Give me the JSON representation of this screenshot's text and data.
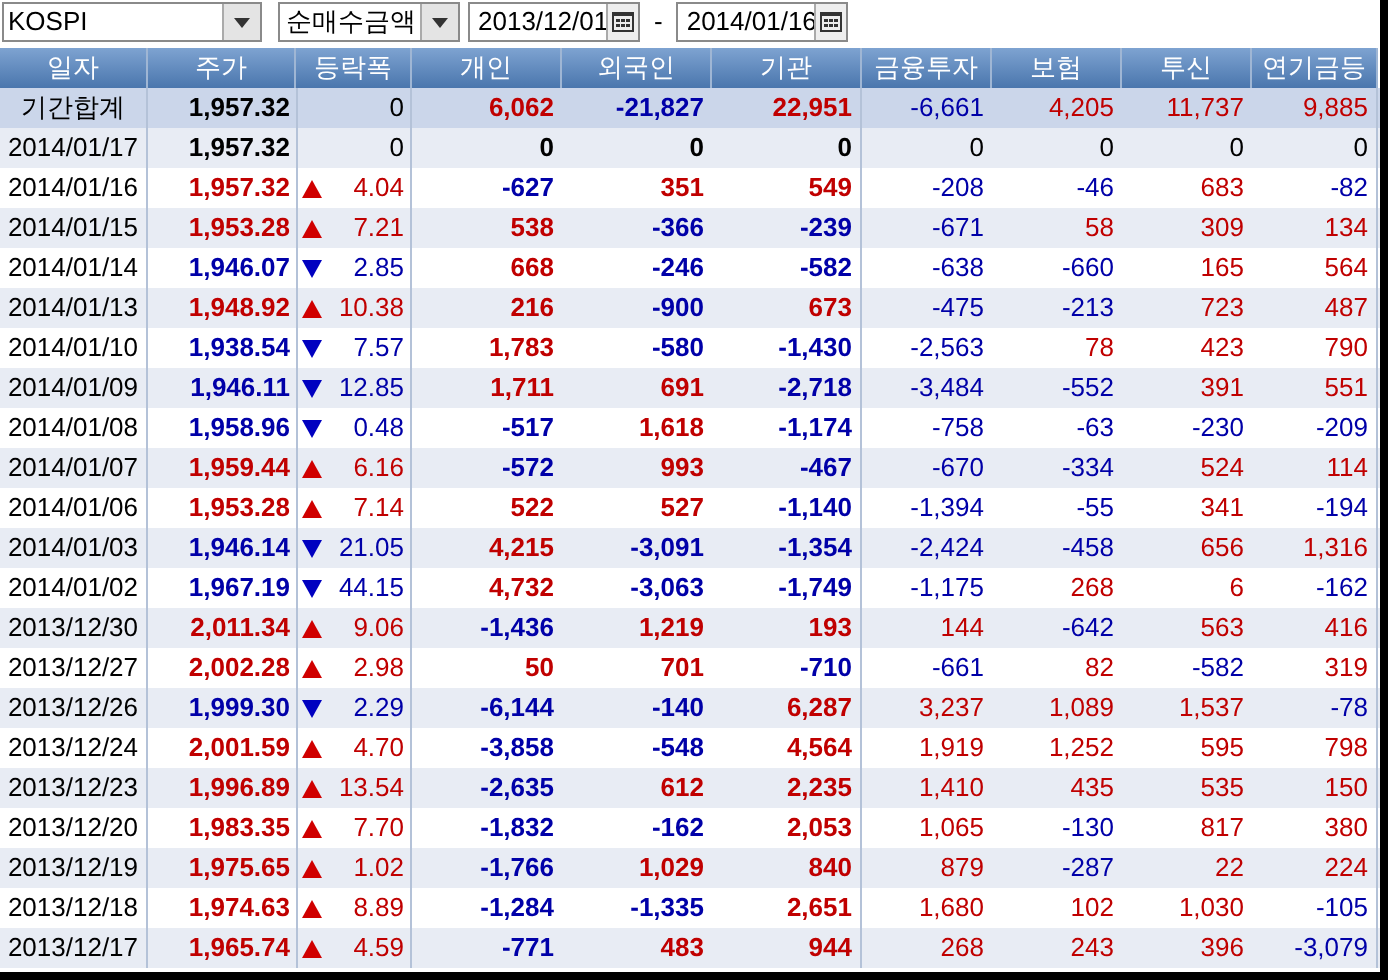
{
  "toolbar": {
    "market": "KOSPI",
    "measure": "순매수금액",
    "start_date": "2013/12/01",
    "separator": "-",
    "end_date": "2014/01/16"
  },
  "table": {
    "columns": [
      "일자",
      "주가",
      "등락폭",
      "개인",
      "외국인",
      "기관",
      "금융투자",
      "보험",
      "투신",
      "연기금등"
    ],
    "rows": [
      {
        "kind": "total",
        "rising": false,
        "falling": false,
        "cells": [
          "기간합계",
          "1,957.32",
          "0",
          "6,062",
          "-21,827",
          "22,951",
          "-6,661",
          "4,205",
          "11,737",
          "9,885"
        ]
      },
      {
        "kind": "day",
        "rising": false,
        "falling": false,
        "cells": [
          "2014/01/17",
          "1,957.32",
          "0",
          "0",
          "0",
          "0",
          "0",
          "0",
          "0",
          "0"
        ]
      },
      {
        "kind": "day",
        "rising": true,
        "falling": false,
        "cells": [
          "2014/01/16",
          "1,957.32",
          "4.04",
          "-627",
          "351",
          "549",
          "-208",
          "-46",
          "683",
          "-82"
        ]
      },
      {
        "kind": "day",
        "rising": true,
        "falling": false,
        "cells": [
          "2014/01/15",
          "1,953.28",
          "7.21",
          "538",
          "-366",
          "-239",
          "-671",
          "58",
          "309",
          "134"
        ]
      },
      {
        "kind": "day",
        "rising": false,
        "falling": true,
        "cells": [
          "2014/01/14",
          "1,946.07",
          "2.85",
          "668",
          "-246",
          "-582",
          "-638",
          "-660",
          "165",
          "564"
        ]
      },
      {
        "kind": "day",
        "rising": true,
        "falling": false,
        "cells": [
          "2014/01/13",
          "1,948.92",
          "10.38",
          "216",
          "-900",
          "673",
          "-475",
          "-213",
          "723",
          "487"
        ]
      },
      {
        "kind": "day",
        "rising": false,
        "falling": true,
        "cells": [
          "2014/01/10",
          "1,938.54",
          "7.57",
          "1,783",
          "-580",
          "-1,430",
          "-2,563",
          "78",
          "423",
          "790"
        ]
      },
      {
        "kind": "day",
        "rising": false,
        "falling": true,
        "cells": [
          "2014/01/09",
          "1,946.11",
          "12.85",
          "1,711",
          "691",
          "-2,718",
          "-3,484",
          "-552",
          "391",
          "551"
        ]
      },
      {
        "kind": "day",
        "rising": false,
        "falling": true,
        "cells": [
          "2014/01/08",
          "1,958.96",
          "0.48",
          "-517",
          "1,618",
          "-1,174",
          "-758",
          "-63",
          "-230",
          "-209"
        ]
      },
      {
        "kind": "day",
        "rising": true,
        "falling": false,
        "cells": [
          "2014/01/07",
          "1,959.44",
          "6.16",
          "-572",
          "993",
          "-467",
          "-670",
          "-334",
          "524",
          "114"
        ]
      },
      {
        "kind": "day",
        "rising": true,
        "falling": false,
        "cells": [
          "2014/01/06",
          "1,953.28",
          "7.14",
          "522",
          "527",
          "-1,140",
          "-1,394",
          "-55",
          "341",
          "-194"
        ]
      },
      {
        "kind": "day",
        "rising": false,
        "falling": true,
        "cells": [
          "2014/01/03",
          "1,946.14",
          "21.05",
          "4,215",
          "-3,091",
          "-1,354",
          "-2,424",
          "-458",
          "656",
          "1,316"
        ]
      },
      {
        "kind": "day",
        "rising": false,
        "falling": true,
        "cells": [
          "2014/01/02",
          "1,967.19",
          "44.15",
          "4,732",
          "-3,063",
          "-1,749",
          "-1,175",
          "268",
          "6",
          "-162"
        ]
      },
      {
        "kind": "day",
        "rising": true,
        "falling": false,
        "cells": [
          "2013/12/30",
          "2,011.34",
          "9.06",
          "-1,436",
          "1,219",
          "193",
          "144",
          "-642",
          "563",
          "416"
        ]
      },
      {
        "kind": "day",
        "rising": true,
        "falling": false,
        "cells": [
          "2013/12/27",
          "2,002.28",
          "2.98",
          "50",
          "701",
          "-710",
          "-661",
          "82",
          "-582",
          "319"
        ]
      },
      {
        "kind": "day",
        "rising": false,
        "falling": true,
        "cells": [
          "2013/12/26",
          "1,999.30",
          "2.29",
          "-6,144",
          "-140",
          "6,287",
          "3,237",
          "1,089",
          "1,537",
          "-78"
        ]
      },
      {
        "kind": "day",
        "rising": true,
        "falling": false,
        "cells": [
          "2013/12/24",
          "2,001.59",
          "4.70",
          "-3,858",
          "-548",
          "4,564",
          "1,919",
          "1,252",
          "595",
          "798"
        ]
      },
      {
        "kind": "day",
        "rising": true,
        "falling": false,
        "cells": [
          "2013/12/23",
          "1,996.89",
          "13.54",
          "-2,635",
          "612",
          "2,235",
          "1,410",
          "435",
          "535",
          "150"
        ]
      },
      {
        "kind": "day",
        "rising": true,
        "falling": false,
        "cells": [
          "2013/12/20",
          "1,983.35",
          "7.70",
          "-1,832",
          "-162",
          "2,053",
          "1,065",
          "-130",
          "817",
          "380"
        ]
      },
      {
        "kind": "day",
        "rising": true,
        "falling": false,
        "cells": [
          "2013/12/19",
          "1,975.65",
          "1.02",
          "-1,766",
          "1,029",
          "840",
          "879",
          "-287",
          "22",
          "224"
        ]
      },
      {
        "kind": "day",
        "rising": true,
        "falling": false,
        "cells": [
          "2013/12/18",
          "1,974.63",
          "8.89",
          "-1,284",
          "-1,335",
          "2,651",
          "1,680",
          "102",
          "1,030",
          "-105"
        ]
      },
      {
        "kind": "day",
        "rising": true,
        "falling": false,
        "cells": [
          "2013/12/17",
          "1,965.74",
          "4.59",
          "-771",
          "483",
          "944",
          "268",
          "243",
          "396",
          "-3,079"
        ]
      }
    ]
  }
}
